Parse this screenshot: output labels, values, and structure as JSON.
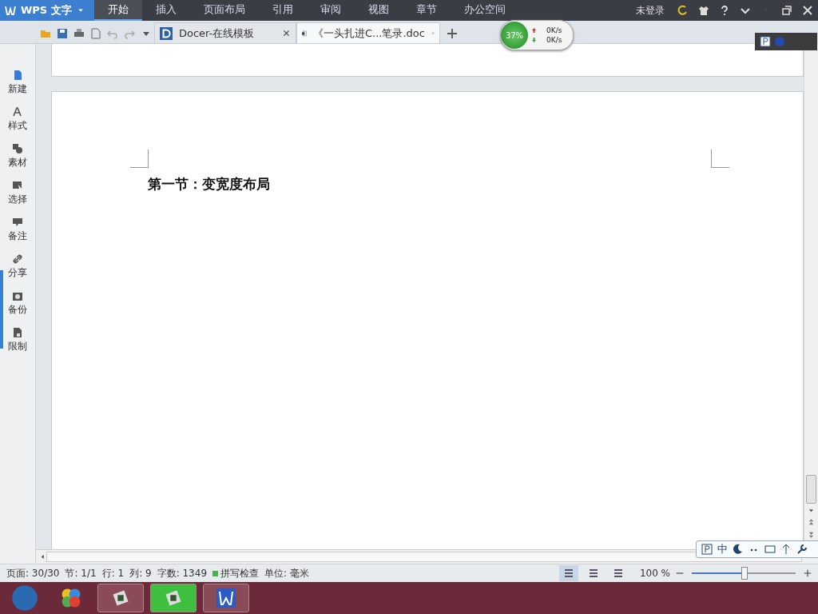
{
  "app": {
    "title": "WPS 文字",
    "menu": [
      {
        "label": "开始",
        "selected": true
      },
      {
        "label": "插入",
        "selected": false
      },
      {
        "label": "页面布局",
        "selected": false
      },
      {
        "label": "引用",
        "selected": false
      },
      {
        "label": "审阅",
        "selected": false
      },
      {
        "label": "视图",
        "selected": false
      },
      {
        "label": "章节",
        "selected": false
      },
      {
        "label": "办公空间",
        "selected": false
      }
    ],
    "login": "未登录"
  },
  "doc_tabs": [
    {
      "label": "Docer-在线模板",
      "kind": "docer",
      "selected": false
    },
    {
      "label": "《一头扎进C...笔录.doc",
      "kind": "doc",
      "selected": true
    }
  ],
  "net_widget": {
    "percent": "37%",
    "up": "0K/s",
    "down": "0K/s"
  },
  "sidebar": [
    {
      "label": "新建"
    },
    {
      "label": "样式"
    },
    {
      "label": "素材"
    },
    {
      "label": "选择"
    },
    {
      "label": "备注"
    },
    {
      "label": "分享"
    },
    {
      "label": "备份"
    },
    {
      "label": "限制"
    }
  ],
  "document": {
    "heading": "第一节：变宽度布局"
  },
  "ime_bar": {
    "mode": "中"
  },
  "status_bar": [
    {
      "label": "页面: 30/30"
    },
    {
      "label": "节: 1/1"
    },
    {
      "label": "行: 1"
    },
    {
      "label": "列: 9"
    },
    {
      "label": "字数: 1349"
    },
    {
      "label": "拼写检查",
      "kind": "check"
    },
    {
      "label": "单位: 毫米"
    }
  ],
  "view_buttons": [
    {
      "selected": true
    },
    {
      "selected": false
    },
    {
      "selected": false
    }
  ],
  "zoom": {
    "reading": "100 %",
    "level": 0.5
  },
  "taskbar": [
    {
      "kind": "start"
    },
    {
      "kind": "apps"
    },
    {
      "kind": "app1",
      "selected": false
    },
    {
      "kind": "app2",
      "selected": true
    },
    {
      "kind": "wps",
      "selected": false
    }
  ]
}
